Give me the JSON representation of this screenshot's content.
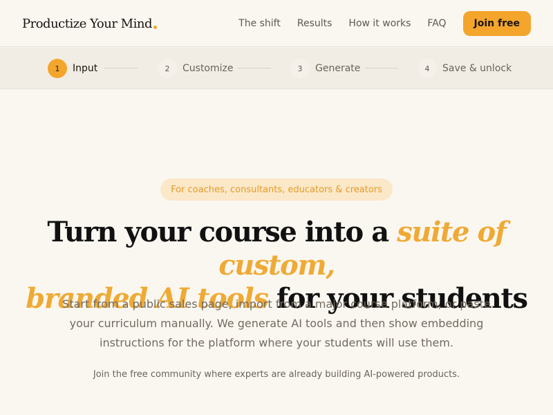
{
  "brand": {
    "name": "Productize Your Mind",
    "accent_color": "#f0a92c"
  },
  "nav": {
    "links": [
      "The shift",
      "Results",
      "How it works",
      "FAQ"
    ],
    "join_label": "Join free"
  },
  "steps": [
    {
      "num": "1",
      "label": "Input",
      "active": true
    },
    {
      "num": "2",
      "label": "Customize",
      "active": false
    },
    {
      "num": "3",
      "label": "Generate",
      "active": false
    },
    {
      "num": "4",
      "label": "Save & unlock",
      "active": false
    }
  ],
  "hero": {
    "pill": "For coaches, consultants, educators & creators",
    "headline_part1": "Turn your course into a ",
    "headline_accent1": "suite of custom,",
    "headline_accent2": "branded AI tools",
    "headline_part2": " for your students",
    "sub_line1": "Start from a public sales page, import from a major course platform, or paste",
    "sub_line2": "your curriculum manually. We generate AI tools and then show embedding",
    "sub_line3": "instructions for the platform where your students will use them.",
    "community": "Join the free community where experts are already building AI-powered products."
  },
  "colors": {
    "accent": "#f3a52c",
    "background": "#faf7f1",
    "steps_background": "#f1ede5"
  }
}
